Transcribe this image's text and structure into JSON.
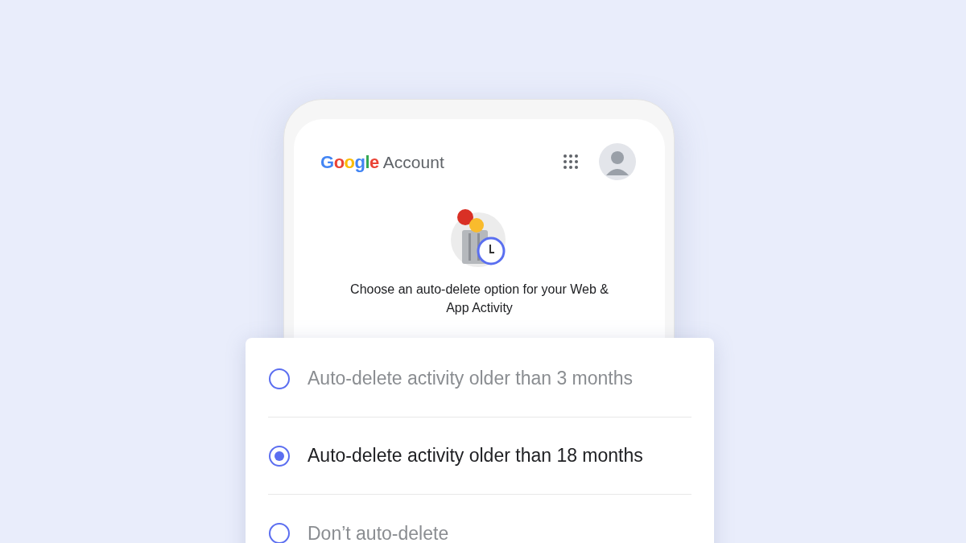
{
  "header": {
    "logo": "Google",
    "title": "Account"
  },
  "intro": "Choose an auto-delete option for your Web & App Activity",
  "options": [
    {
      "label": "Auto-delete activity older than 3 months",
      "selected": false
    },
    {
      "label": "Auto-delete activity older than 18 months",
      "selected": true
    },
    {
      "label": "Don’t auto-delete",
      "selected": false
    }
  ]
}
